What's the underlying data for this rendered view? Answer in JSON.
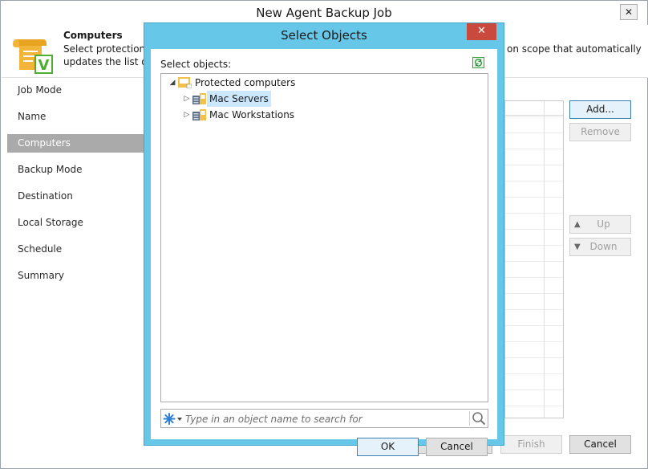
{
  "window": {
    "title": "New Agent Backup Job",
    "close_glyph": "✕"
  },
  "header": {
    "title": "Computers",
    "desc_line1_start": "Select protection g",
    "desc_line1_end": "on scope that automatically",
    "desc_line2": "updates the list of p",
    "icon": "scroll-check-icon"
  },
  "steps": [
    {
      "label": "Job Mode"
    },
    {
      "label": "Name"
    },
    {
      "label": "Computers",
      "active": true
    },
    {
      "label": "Backup Mode"
    },
    {
      "label": "Destination"
    },
    {
      "label": "Local Storage"
    },
    {
      "label": "Schedule"
    },
    {
      "label": "Summary"
    }
  ],
  "side_buttons": {
    "add": "Add...",
    "remove": "Remove",
    "up": "Up",
    "down": "Down"
  },
  "wizard_buttons": {
    "finish": "Finish",
    "cancel": "Cancel"
  },
  "dialog": {
    "title": "Select Objects",
    "close_glyph": "✕",
    "select_label": "Select objects:",
    "tree": {
      "root": {
        "label": "Protected computers",
        "expander": "◢"
      },
      "children": [
        {
          "label": "Mac Servers",
          "expander": "▷",
          "selected": true
        },
        {
          "label": "Mac Workstations",
          "expander": "▷"
        }
      ]
    },
    "search": {
      "placeholder": "Type in an object name to search for"
    },
    "ok": "OK",
    "cancel": "Cancel"
  },
  "colors": {
    "dialog_frame": "#66c7e8",
    "close_red": "#c94a3c",
    "selection": "#cce8ff",
    "active_step": "#aaaaaa"
  }
}
